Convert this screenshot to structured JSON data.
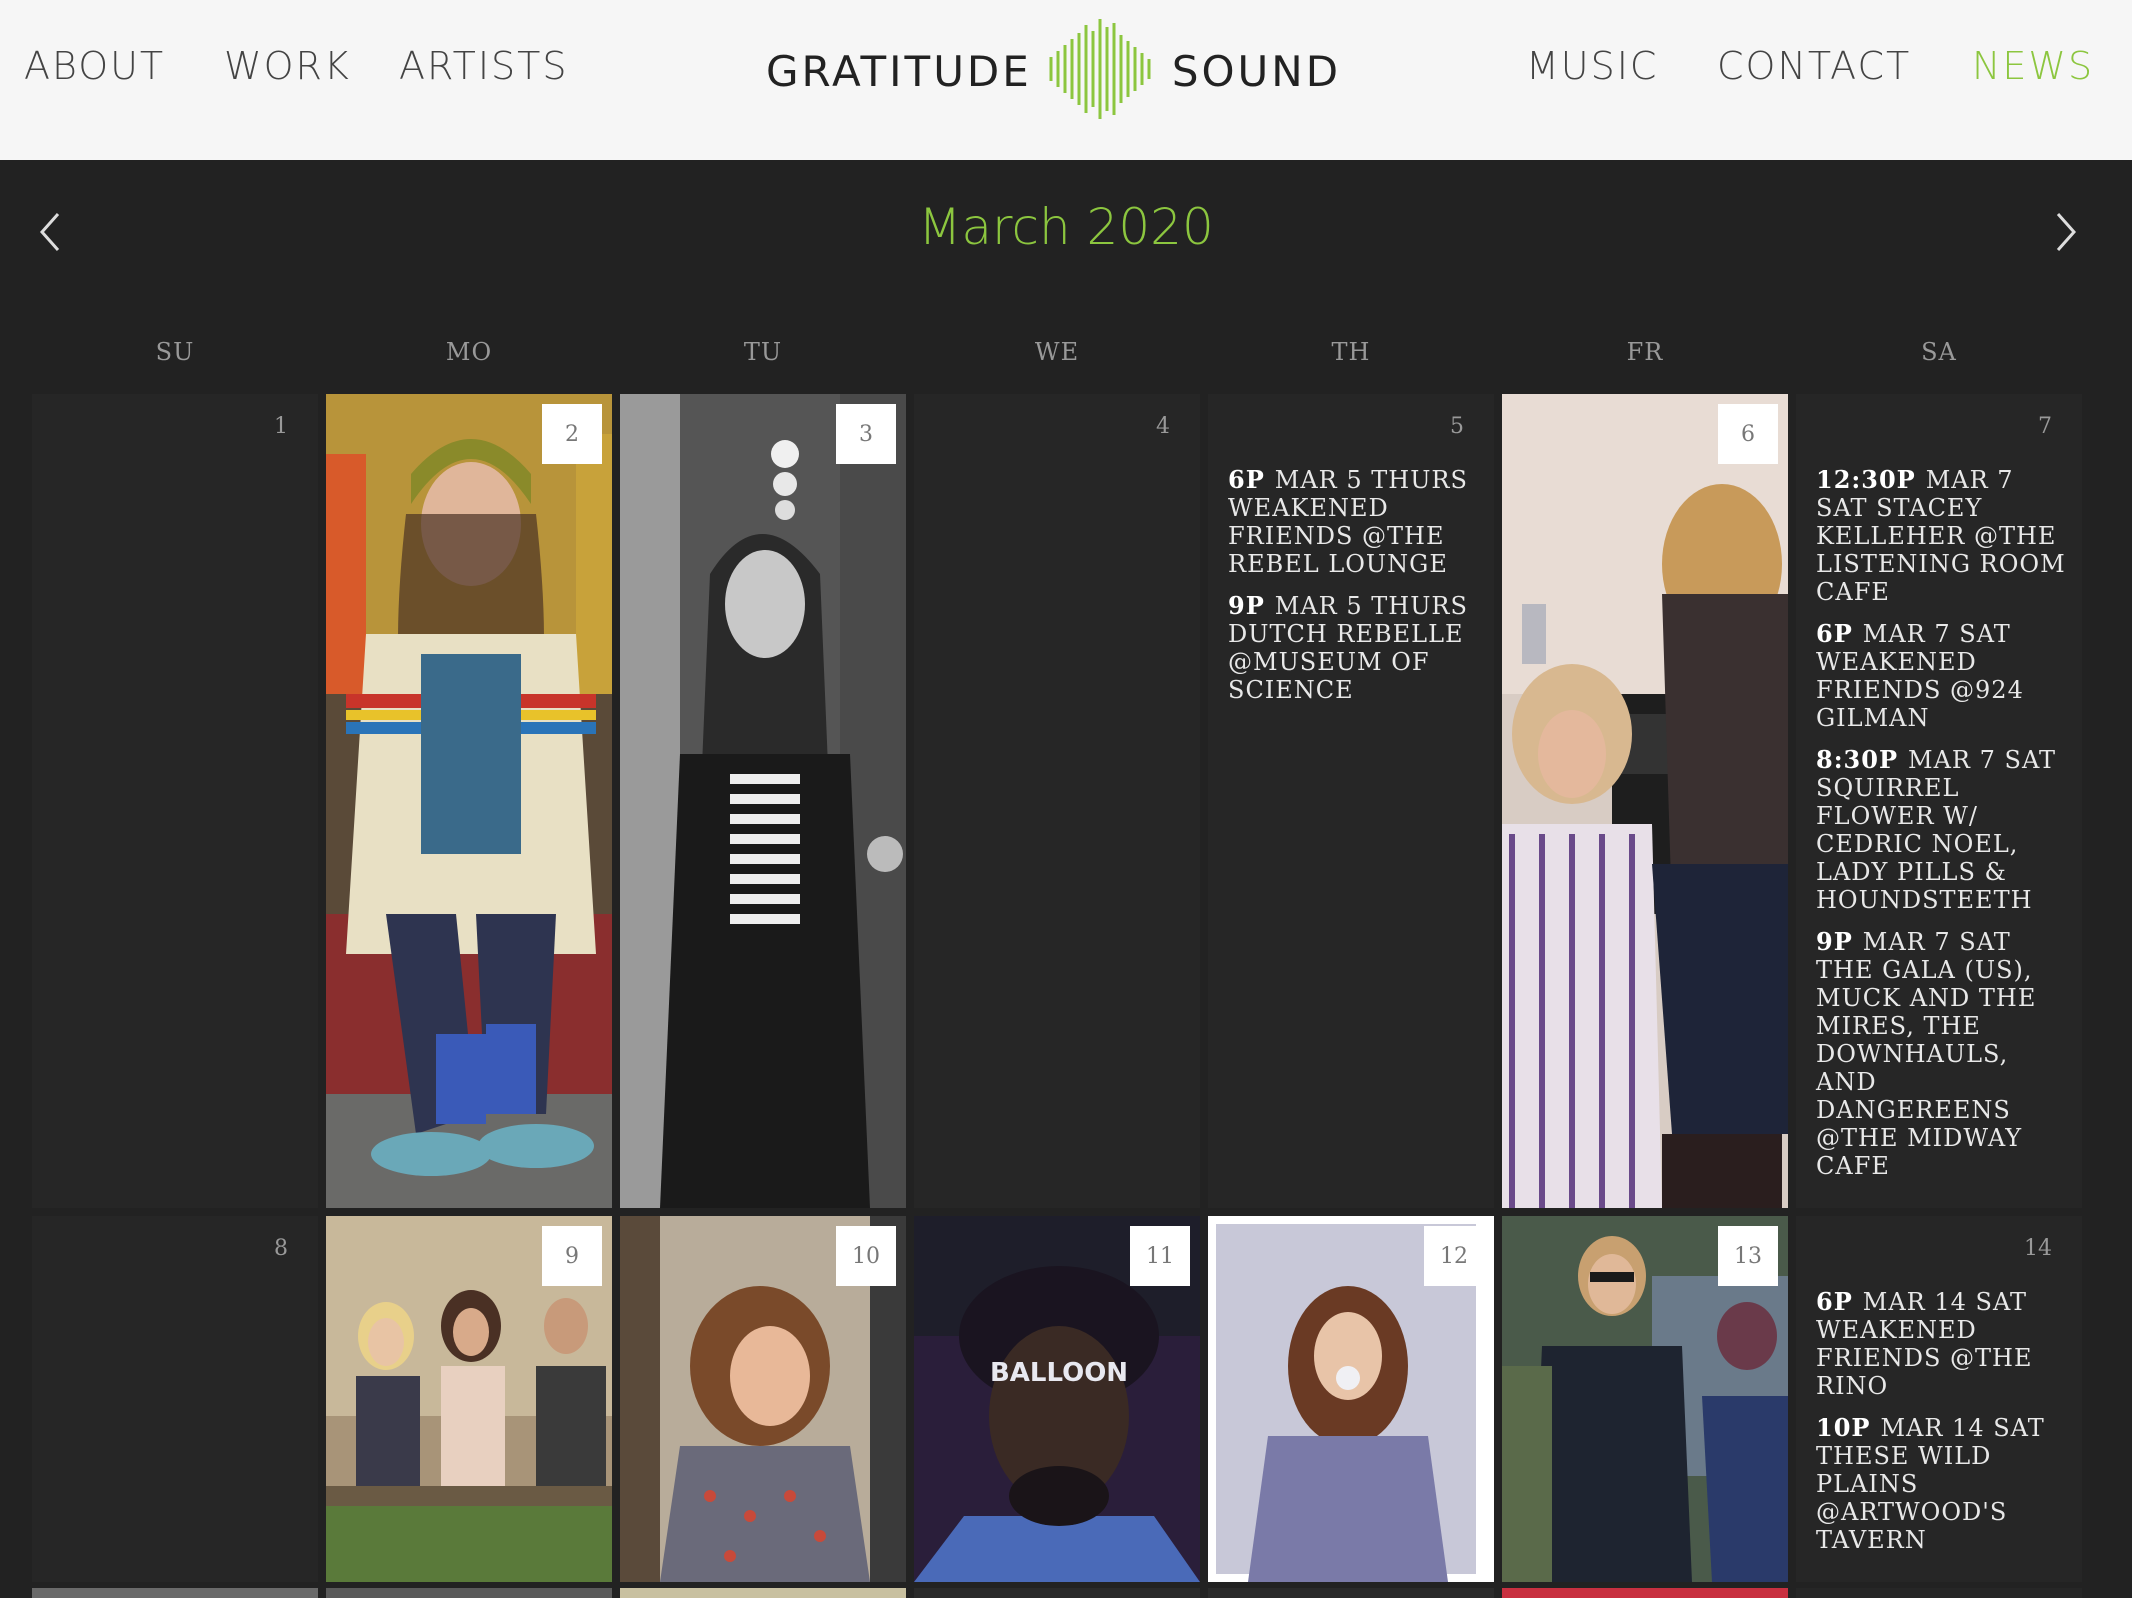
{
  "nav": {
    "left": [
      "ABOUT",
      "WORK",
      "ARTISTS"
    ],
    "right": [
      "MUSIC",
      "CONTACT",
      "NEWS"
    ],
    "active": "NEWS",
    "accent": "#8cc63f"
  },
  "logo": {
    "word1": "GRATITUDE",
    "word2": "SOUND",
    "mark": "soundwave-icon"
  },
  "calendar": {
    "title": "March 2020",
    "prev_icon": "chevron-left-icon",
    "next_icon": "chevron-right-icon",
    "weekdays": [
      "SU",
      "MO",
      "TU",
      "WE",
      "TH",
      "FR",
      "SA"
    ],
    "days": [
      {
        "num": "1"
      },
      {
        "num": "2",
        "photo": "woman-beanie-sweater"
      },
      {
        "num": "3",
        "photo": "woman-bw-portrait"
      },
      {
        "num": "4"
      },
      {
        "num": "5",
        "events": [
          {
            "time": "6P",
            "text": "MAR 5 THURS WEAKENED FRIENDS @THE REBEL LOUNGE"
          },
          {
            "time": "9P",
            "text": "MAR 5 THURS DUTCH REBELLE @MUSEUM OF SCIENCE"
          }
        ]
      },
      {
        "num": "6",
        "photo": "band-seated-group"
      },
      {
        "num": "7",
        "events": [
          {
            "time": "12:30P",
            "text": "MAR 7 SAT STACEY KELLEHER @THE LISTENING ROOM CAFE"
          },
          {
            "time": "6P",
            "text": "MAR 7 SAT WEAKENED FRIENDS @924 GILMAN"
          },
          {
            "time": "8:30P",
            "text": "MAR 7 SAT SQUIRREL FLOWER W/ CEDRIC NOEL, LADY PILLS & HOUNDSTEETH"
          },
          {
            "time": "9P",
            "text": "MAR 7 SAT THE GALA (US), MUCK AND THE MIRES, THE DOWNHAULS, AND DANGEREENS @THE MIDWAY CAFE"
          }
        ]
      },
      {
        "num": "8"
      },
      {
        "num": "9",
        "photo": "trio-on-steps"
      },
      {
        "num": "10",
        "photo": "woman-laughing"
      },
      {
        "num": "11",
        "photo": "man-balloon-forehead"
      },
      {
        "num": "12",
        "photo": "woman-bubblegum"
      },
      {
        "num": "13",
        "photo": "band-sunglasses"
      },
      {
        "num": "14",
        "events": [
          {
            "time": "6P",
            "text": "MAR 14 SAT WEAKENED FRIENDS @THE RINO"
          },
          {
            "time": "10P",
            "text": "MAR 14 SAT THESE WILD PLAINS @ARTWOOD'S TAVERN"
          }
        ]
      }
    ]
  }
}
